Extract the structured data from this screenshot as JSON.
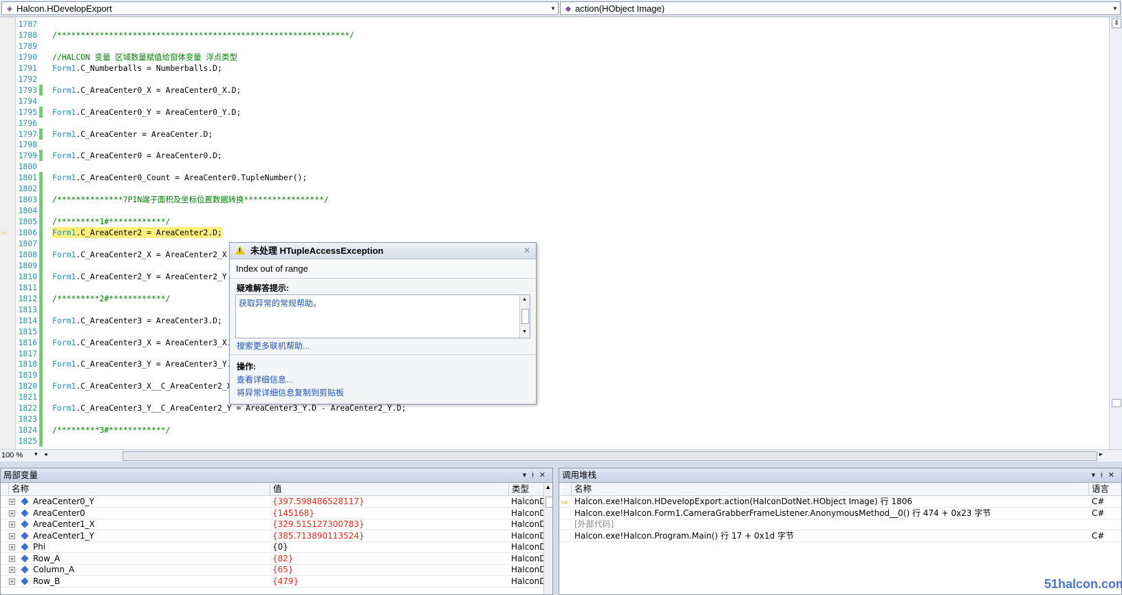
{
  "top": {
    "class_combo": "Halcon.HDevelopExport",
    "method_combo": "action(HObject Image)"
  },
  "editor": {
    "zoom": "100 %",
    "lines": [
      {
        "n": "1787",
        "t": "",
        "k": "plain",
        "chg": false
      },
      {
        "n": "1788",
        "t": "/**************************************************************/",
        "k": "comment",
        "chg": false
      },
      {
        "n": "1789",
        "t": "",
        "k": "plain",
        "chg": false
      },
      {
        "n": "1790",
        "t": "//HALCON 变量 区域数量赋值给窗体变量 浮点类型",
        "k": "comment",
        "chg": false
      },
      {
        "n": "1791",
        "cls": "Form1",
        "t": ".C_Numberballs = Numberballs.D;",
        "k": "code",
        "chg": false
      },
      {
        "n": "1792",
        "t": "",
        "k": "plain",
        "chg": false
      },
      {
        "n": "1793",
        "cls": "Form1",
        "t": ".C_AreaCenter0_X = AreaCenter0_X.D;",
        "k": "code",
        "chg": true
      },
      {
        "n": "1794",
        "t": "",
        "k": "plain",
        "chg": false
      },
      {
        "n": "1795",
        "cls": "Form1",
        "t": ".C_AreaCenter0_Y = AreaCenter0_Y.D;",
        "k": "code",
        "chg": true
      },
      {
        "n": "1796",
        "t": "",
        "k": "plain",
        "chg": false
      },
      {
        "n": "1797",
        "cls": "Form1",
        "t": ".C_AreaCenter = AreaCenter.D;",
        "k": "code",
        "chg": true
      },
      {
        "n": "1798",
        "t": "",
        "k": "plain",
        "chg": false
      },
      {
        "n": "1799",
        "cls": "Form1",
        "t": ".C_AreaCenter0 = AreaCenter0.D;",
        "k": "code",
        "chg": true
      },
      {
        "n": "1800",
        "t": "",
        "k": "plain",
        "chg": false
      },
      {
        "n": "1801",
        "cls": "Form1",
        "t": ".C_AreaCenter0_Count = AreaCenter0.TupleNumber();",
        "k": "code",
        "chg": true
      },
      {
        "n": "1802",
        "t": "",
        "k": "plain",
        "chg": true
      },
      {
        "n": "1803",
        "t": "/**************7PIN端子面积及坐标位置数据转换*****************/",
        "k": "comment",
        "chg": true
      },
      {
        "n": "1804",
        "t": "",
        "k": "plain",
        "chg": true
      },
      {
        "n": "1805",
        "t": "/*********1#************/",
        "k": "comment",
        "chg": true
      },
      {
        "n": "1806",
        "cls": "Form1",
        "t": ".C_AreaCenter2 = AreaCenter2.D;",
        "k": "code",
        "chg": true,
        "current": true
      },
      {
        "n": "1807",
        "t": "",
        "k": "plain",
        "chg": true
      },
      {
        "n": "1808",
        "cls": "Form1",
        "t": ".C_AreaCenter2_X = AreaCenter2_X",
        "k": "code",
        "chg": true
      },
      {
        "n": "1809",
        "t": "",
        "k": "plain",
        "chg": true
      },
      {
        "n": "1810",
        "cls": "Form1",
        "t": ".C_AreaCenter2_Y = AreaCenter2_Y",
        "k": "code",
        "chg": true
      },
      {
        "n": "1811",
        "t": "",
        "k": "plain",
        "chg": true
      },
      {
        "n": "1812",
        "t": "/*********2#************/",
        "k": "comment",
        "chg": true
      },
      {
        "n": "1813",
        "t": "",
        "k": "plain",
        "chg": true
      },
      {
        "n": "1814",
        "cls": "Form1",
        "t": ".C_AreaCenter3 = AreaCenter3.D;",
        "k": "code",
        "chg": true
      },
      {
        "n": "1815",
        "t": "",
        "k": "plain",
        "chg": true
      },
      {
        "n": "1816",
        "cls": "Form1",
        "t": ".C_AreaCenter3_X = AreaCenter3_X.",
        "k": "code",
        "chg": true
      },
      {
        "n": "1817",
        "t": "",
        "k": "plain",
        "chg": true
      },
      {
        "n": "1818",
        "cls": "Form1",
        "t": ".C_AreaCenter3_Y = AreaCenter3_Y.",
        "k": "code",
        "chg": true
      },
      {
        "n": "1819",
        "t": "",
        "k": "plain",
        "chg": true
      },
      {
        "n": "1820",
        "cls": "Form1",
        "t": ".C_AreaCenter3_X__C_AreaCenter2_X",
        "k": "code",
        "chg": true
      },
      {
        "n": "1821",
        "t": "",
        "k": "plain",
        "chg": true
      },
      {
        "n": "1822",
        "cls": "Form1",
        "t": ".C_AreaCenter3_Y__C_AreaCenter2_Y = AreaCenter3_Y.D - AreaCenter2_Y.D;",
        "k": "code",
        "chg": true
      },
      {
        "n": "1823",
        "t": "",
        "k": "plain",
        "chg": true
      },
      {
        "n": "1824",
        "t": "/*********3#************/",
        "k": "comment",
        "chg": true
      },
      {
        "n": "1825",
        "t": "",
        "k": "plain",
        "chg": true
      }
    ]
  },
  "exception": {
    "title": "未处理 HTupleAccessException",
    "message": "Index out of range",
    "tips_heading": "疑难解答提示:",
    "tip_link": "获取异常的常规帮助。",
    "more_help": "搜索更多联机帮助...",
    "actions_heading": "操作:",
    "action_details": "查看详细信息...",
    "action_copy": "将异常详细信息复制到剪贴板"
  },
  "locals": {
    "title": "局部变量",
    "col_name": "名称",
    "col_value": "值",
    "col_type": "类型",
    "rows": [
      {
        "name": "AreaCenter0_Y",
        "value": "{397.598486528117}",
        "type": "HalconD",
        "red": true
      },
      {
        "name": "AreaCenter0",
        "value": "{145168}",
        "type": "HalconD",
        "red": true
      },
      {
        "name": "AreaCenter1_X",
        "value": "{329.515127300783}",
        "type": "HalconD",
        "red": true
      },
      {
        "name": "AreaCenter1_Y",
        "value": "{385.713890113524}",
        "type": "HalconD",
        "red": true
      },
      {
        "name": "Phi",
        "value": "{0}",
        "type": "HalconD",
        "red": false
      },
      {
        "name": "Row_A",
        "value": "{82}",
        "type": "HalconD",
        "red": true
      },
      {
        "name": "Column_A",
        "value": "{65}",
        "type": "HalconD",
        "red": true
      },
      {
        "name": "Row_B",
        "value": "{479}",
        "type": "HalconD",
        "red": true
      }
    ]
  },
  "callstack": {
    "title": "调用堆栈",
    "col_name": "名称",
    "col_lang": "语言",
    "rows": [
      {
        "name": "Halcon.exe!Halcon.HDevelopExport.action(HalconDotNet.HObject Image) 行 1806",
        "lang": "C#",
        "current": true,
        "gray": false
      },
      {
        "name": "Halcon.exe!Halcon.Form1.CameraGrabberFrameListener.AnonymousMethod__0() 行 474 + 0x23 字节",
        "lang": "C#",
        "current": false,
        "gray": false
      },
      {
        "name": "[外部代码]",
        "lang": "",
        "current": false,
        "gray": true
      },
      {
        "name": "Halcon.exe!Halcon.Program.Main() 行 17 + 0x1d 字节",
        "lang": "C#",
        "current": false,
        "gray": false
      }
    ]
  },
  "watermark": "51halcon.com"
}
